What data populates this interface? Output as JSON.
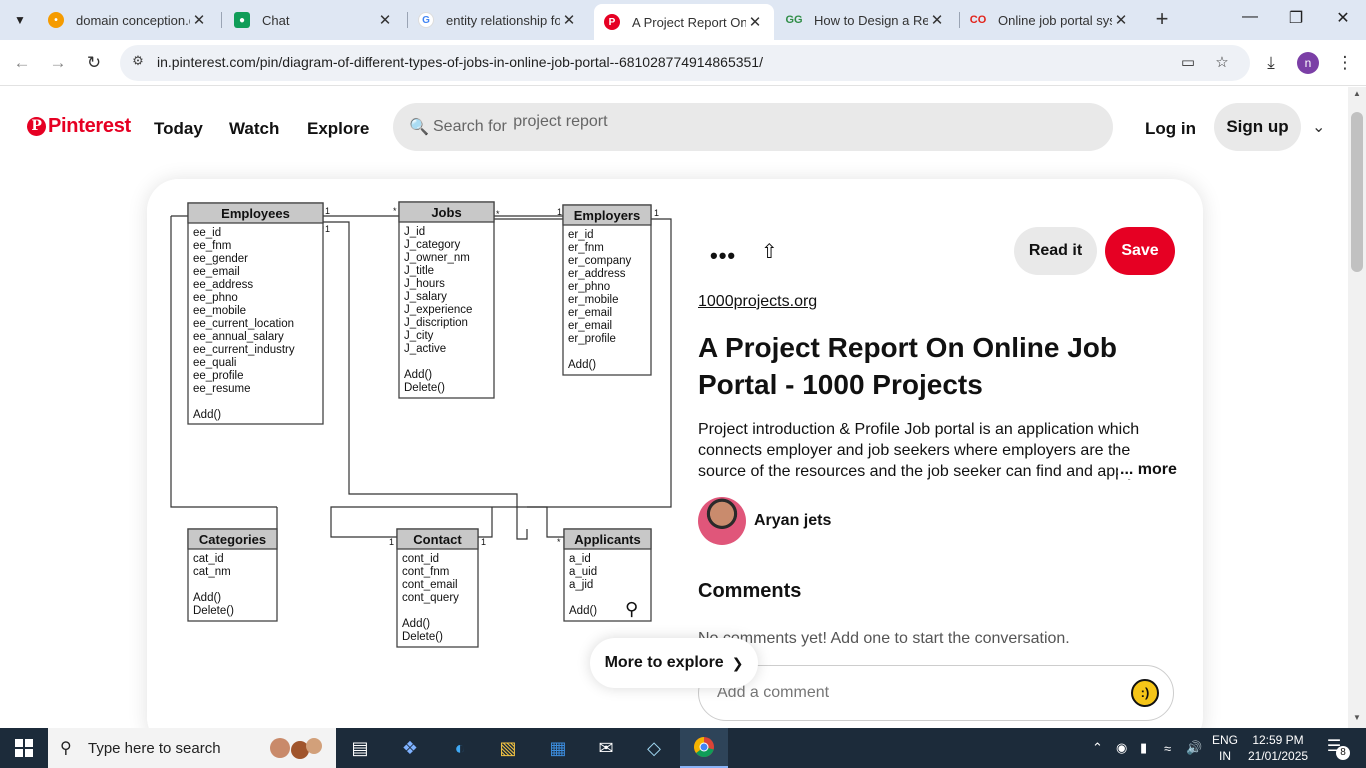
{
  "browser": {
    "tabs": [
      {
        "title": "domain conception.d",
        "icon": "orange-dots-icon",
        "color": "#f59b00",
        "active": false
      },
      {
        "title": "Chat",
        "icon": "chat-icon",
        "color": "#0f9d58",
        "active": false
      },
      {
        "title": "entity relationship for",
        "icon": "google-icon",
        "color": "#ffffff",
        "active": false
      },
      {
        "title": "A Project Report On O",
        "icon": "pinterest-icon",
        "color": "#e60023",
        "active": true
      },
      {
        "title": "How to Design a Rela",
        "icon": "gg-icon",
        "color": "#2f8d46",
        "active": false
      },
      {
        "title": "Online job portal syst",
        "icon": "co-icon",
        "color": "#e2231a",
        "active": false
      }
    ],
    "url": "in.pinterest.com/pin/diagram-of-different-types-of-jobs-in-online-job-portal--681028774914865351/",
    "profile_initial": "n"
  },
  "header": {
    "logo": "Pinterest",
    "nav": [
      "Today",
      "Watch",
      "Explore"
    ],
    "search_placeholder": "Search for",
    "search_term": "project report",
    "login": "Log in",
    "signup": "Sign up"
  },
  "pin": {
    "read_it": "Read it",
    "save": "Save",
    "domain": "1000projects.org",
    "title": "A Project Report On Online Job Portal - 1000 Projects",
    "description": "Project introduction & Profile Job portal is an application which connects employer and job seekers where employers are the source of the resources and the job seeker can find and apply for jobs",
    "more": "... more",
    "author": "Aryan jets",
    "comments_heading": "Comments",
    "no_comments": "No comments yet! Add one to start the conversation.",
    "comment_placeholder": "Add a comment",
    "more_to_explore": "More to explore"
  },
  "diagram": {
    "entities": [
      {
        "name": "Employees",
        "attributes": [
          "ee_id",
          "ee_fnm",
          "ee_gender",
          "ee_email",
          "ee_address",
          "ee_phno",
          "ee_mobile",
          "ee_current_location",
          "ee_annual_salary",
          "ee_current_industry",
          "ee_quali",
          "ee_profile",
          "ee_resume"
        ],
        "methods": [
          "Add()"
        ]
      },
      {
        "name": "Jobs",
        "attributes": [
          "J_id",
          "J_category",
          "J_owner_nm",
          "J_title",
          "J_hours",
          "J_salary",
          "J_experience",
          "J_discription",
          "J_city",
          "J_active"
        ],
        "methods": [
          "Add()",
          "Delete()"
        ]
      },
      {
        "name": "Employers",
        "attributes": [
          "er_id",
          "er_fnm",
          "er_company",
          "er_address",
          "er_phno",
          "er_mobile",
          "er_email",
          "er_email",
          "er_profile"
        ],
        "methods": [
          "Add()"
        ]
      },
      {
        "name": "Categories",
        "attributes": [
          "cat_id",
          "cat_nm"
        ],
        "methods": [
          "Add()",
          "Delete()"
        ]
      },
      {
        "name": "Contact",
        "attributes": [
          "cont_id",
          "cont_fnm",
          "cont_email",
          "cont_query"
        ],
        "methods": [
          "Add()",
          "Delete()"
        ]
      },
      {
        "name": "Applicants",
        "attributes": [
          "a_id",
          "a_uid",
          "a_jid"
        ],
        "methods": [
          "Add()"
        ]
      }
    ],
    "multiplicity": "1",
    "many": "*"
  },
  "taskbar": {
    "search_placeholder": "Type here to search",
    "lang_line1": "ENG",
    "lang_line2": "IN",
    "time": "12:59 PM",
    "date": "21/01/2025",
    "notif_count": "8"
  }
}
